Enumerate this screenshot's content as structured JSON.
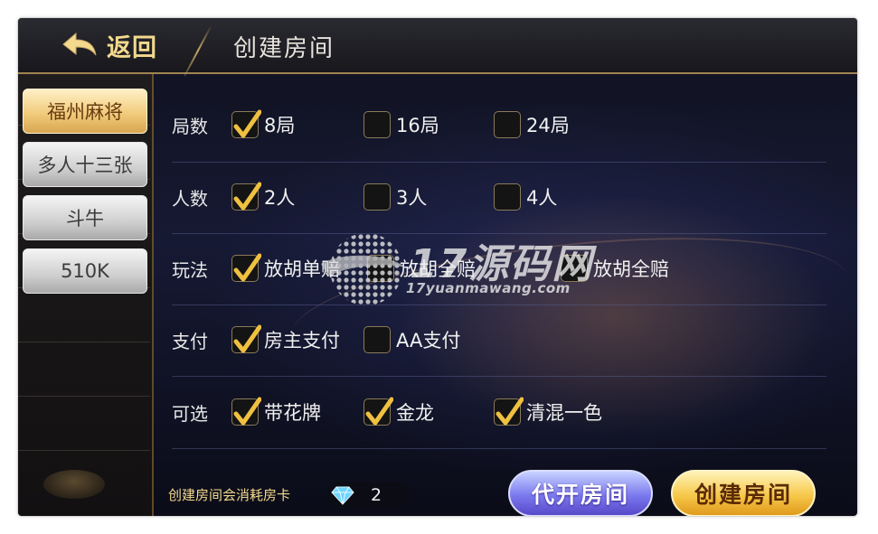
{
  "header": {
    "back_label": "返回",
    "title": "创建房间"
  },
  "sidebar": {
    "items": [
      {
        "label": "福州麻将",
        "active": true
      },
      {
        "label": "多人十三张",
        "active": false
      },
      {
        "label": "斗牛",
        "active": false
      },
      {
        "label": "510K",
        "active": false
      }
    ]
  },
  "options": {
    "rounds": {
      "label": "局数",
      "choices": [
        {
          "text": "8局",
          "checked": true
        },
        {
          "text": "16局",
          "checked": false
        },
        {
          "text": "24局",
          "checked": false
        }
      ]
    },
    "players": {
      "label": "人数",
      "choices": [
        {
          "text": "2人",
          "checked": true
        },
        {
          "text": "3人",
          "checked": false
        },
        {
          "text": "4人",
          "checked": false
        }
      ]
    },
    "rules": {
      "label": "玩法",
      "choices": [
        {
          "text": "放胡单赔",
          "checked": true
        },
        {
          "text": "放胡全赔",
          "checked": false
        },
        {
          "text": "放胡全赔",
          "checked": false
        }
      ]
    },
    "payment": {
      "label": "支付",
      "choices": [
        {
          "text": "房主支付",
          "checked": true
        },
        {
          "text": "AA支付",
          "checked": false
        }
      ]
    },
    "optional": {
      "label": "可选",
      "choices": [
        {
          "text": "带花牌",
          "checked": true
        },
        {
          "text": "金龙",
          "checked": true
        },
        {
          "text": "清混一色",
          "checked": true
        }
      ]
    }
  },
  "footer": {
    "cost_label": "创建房间会消耗房卡",
    "card_count": "2",
    "proxy_button": "代开房间",
    "create_button": "创建房间"
  },
  "watermark": {
    "main": "17源码网",
    "sub": "17yuanmawang.com"
  },
  "icons": {
    "back": "back-arrow-icon",
    "check": "checkmark-icon",
    "gem": "diamond-icon"
  },
  "colors": {
    "accent_gold": "#f2d98e",
    "check_gold": "#f0c040",
    "proxy_button": "#7b79ee",
    "create_button": "#f6c84a"
  }
}
